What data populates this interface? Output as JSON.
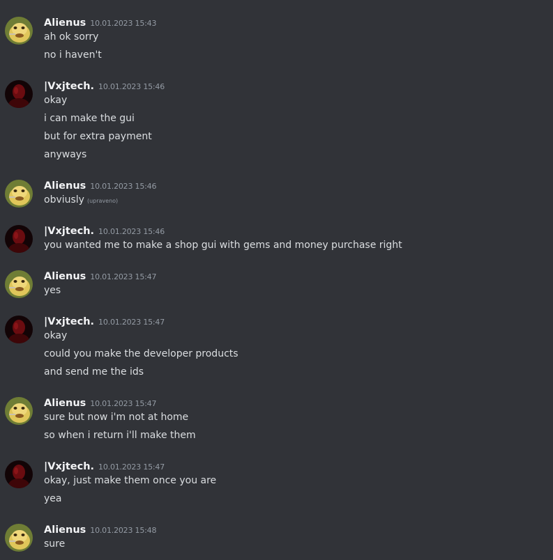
{
  "users": {
    "alienus": {
      "name": "Alienus",
      "avatar_icon": "doge-avatar-icon",
      "avatar_color": "#7a8a3a"
    },
    "vxjtech": {
      "name": "|Vxjtech.",
      "avatar_icon": "dark-red-avatar-icon",
      "avatar_color": "#5a0a0a"
    }
  },
  "groups": [
    {
      "author": "Alienus",
      "time": "10.01.2023 15:43",
      "messages": [
        {
          "text": "ah ok sorry"
        },
        {
          "text": "no i haven't"
        }
      ]
    },
    {
      "author": "|Vxjtech.",
      "time": "10.01.2023 15:46",
      "messages": [
        {
          "text": "okay"
        },
        {
          "text": "i can make the gui"
        },
        {
          "text": "but for extra payment"
        },
        {
          "text": "anyways"
        }
      ]
    },
    {
      "author": "Alienus",
      "time": "10.01.2023 15:46",
      "messages": [
        {
          "text": "obviusly",
          "edited": "(upraveno)"
        }
      ]
    },
    {
      "author": "|Vxjtech.",
      "time": "10.01.2023 15:46",
      "messages": [
        {
          "text": "you wanted me to make a shop gui with gems and money purchase right"
        }
      ]
    },
    {
      "author": "Alienus",
      "time": "10.01.2023 15:47",
      "messages": [
        {
          "text": "yes"
        }
      ]
    },
    {
      "author": "|Vxjtech.",
      "time": "10.01.2023 15:47",
      "messages": [
        {
          "text": "okay"
        },
        {
          "text": "could you make the developer products"
        },
        {
          "text": "and send me the ids"
        }
      ]
    },
    {
      "author": "Alienus",
      "time": "10.01.2023 15:47",
      "messages": [
        {
          "text": "sure but now i'm not at home"
        },
        {
          "text": "so when i return i'll make them"
        }
      ]
    },
    {
      "author": "|Vxjtech.",
      "time": "10.01.2023 15:47",
      "messages": [
        {
          "text": "okay, just make them once you are"
        },
        {
          "text": "yea"
        }
      ]
    },
    {
      "author": "Alienus",
      "time": "10.01.2023 15:48",
      "messages": [
        {
          "text": "sure"
        }
      ]
    }
  ]
}
